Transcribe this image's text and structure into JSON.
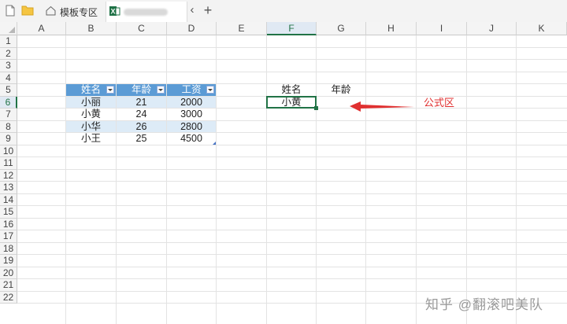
{
  "tabs": {
    "template_label": "模板专区",
    "current_label": ""
  },
  "columns": [
    "A",
    "B",
    "C",
    "D",
    "E",
    "F",
    "G",
    "H",
    "I",
    "J",
    "K"
  ],
  "rows": [
    "1",
    "2",
    "3",
    "4",
    "5",
    "6",
    "7",
    "8",
    "9",
    "10",
    "11",
    "12",
    "13",
    "14",
    "15",
    "16",
    "17",
    "18",
    "19",
    "20",
    "21",
    "22"
  ],
  "table": {
    "headers": [
      "姓名",
      "年龄",
      "工资"
    ],
    "rows": [
      [
        "小丽",
        "21",
        "2000"
      ],
      [
        "小黄",
        "24",
        "3000"
      ],
      [
        "小华",
        "26",
        "2800"
      ],
      [
        "小王",
        "25",
        "4500"
      ]
    ]
  },
  "lookup": {
    "name_header": "姓名",
    "age_header": "年龄",
    "name_value": "小黄"
  },
  "annotation": {
    "label": "公式区",
    "color": "#e03030"
  },
  "watermark": "知乎 @翻滚吧美队",
  "colors": {
    "table_header": "#5b9bd5",
    "table_band": "#ddebf7",
    "selection": "#217346"
  }
}
